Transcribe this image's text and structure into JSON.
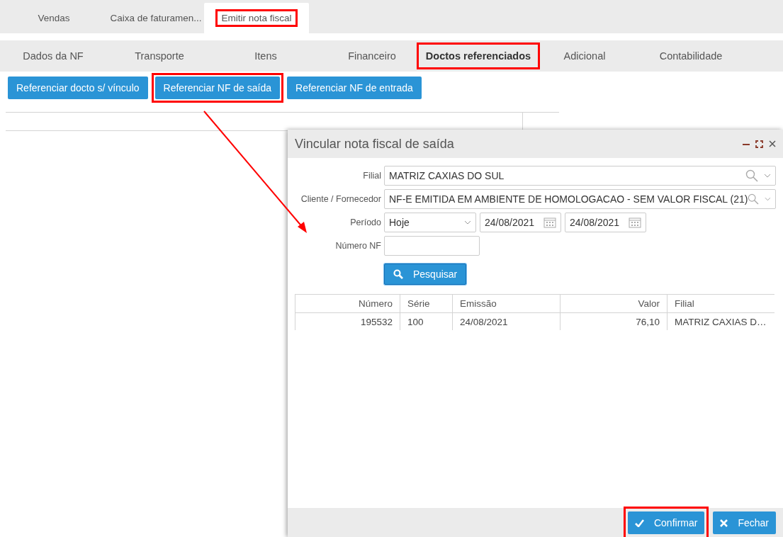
{
  "main_tabs": [
    {
      "label": "Vendas",
      "selected": false,
      "highlighted": false
    },
    {
      "label": "Caixa de faturamen...",
      "selected": false,
      "highlighted": false
    },
    {
      "label": "Emitir nota fiscal",
      "selected": true,
      "highlighted": true
    }
  ],
  "section_tabs": [
    {
      "label": "Dados da NF",
      "selected": false,
      "highlighted": false
    },
    {
      "label": "Transporte",
      "selected": false,
      "highlighted": false
    },
    {
      "label": "Itens",
      "selected": false,
      "highlighted": false
    },
    {
      "label": "Financeiro",
      "selected": false,
      "highlighted": false
    },
    {
      "label": "Doctos referenciados",
      "selected": true,
      "highlighted": true
    },
    {
      "label": "Adicional",
      "selected": false,
      "highlighted": false
    },
    {
      "label": "Contabilidade",
      "selected": false,
      "highlighted": false
    }
  ],
  "action_buttons": [
    {
      "label": "Referenciar docto s/ vínculo",
      "highlighted": false
    },
    {
      "label": "Referenciar NF de saída",
      "highlighted": true
    },
    {
      "label": "Referenciar NF de entrada",
      "highlighted": false
    }
  ],
  "dialog": {
    "title": "Vincular nota fiscal de saída",
    "fields": [
      {
        "kind": "lookup",
        "label": "Filial",
        "value": "MATRIZ CAXIAS DO SUL"
      },
      {
        "kind": "lookup",
        "label": "Cliente / Fornecedor",
        "value": "NF-E EMITIDA EM AMBIENTE DE HOMOLOGACAO - SEM VALOR FISCAL (21)"
      },
      {
        "kind": "period",
        "label": "Período",
        "value": "Hoje",
        "date_from": "24/08/2021",
        "date_to": "24/08/2021"
      },
      {
        "kind": "text",
        "label": "Número NF"
      }
    ],
    "search_button": {
      "label": "Pesquisar"
    },
    "table": {
      "columns": [
        {
          "label": "Número"
        },
        {
          "label": "Série"
        },
        {
          "label": "Emissão"
        },
        {
          "label": "Valor"
        },
        {
          "label": "Filial"
        }
      ],
      "rows": [
        [
          "195532",
          "100",
          "24/08/2021",
          "76,10",
          "MATRIZ CAXIAS D…"
        ]
      ]
    },
    "buttons": [
      {
        "kind": "confirm",
        "label": "Confirmar",
        "highlighted": true
      },
      {
        "kind": "close",
        "label": "Fechar",
        "highlighted": false
      }
    ]
  }
}
